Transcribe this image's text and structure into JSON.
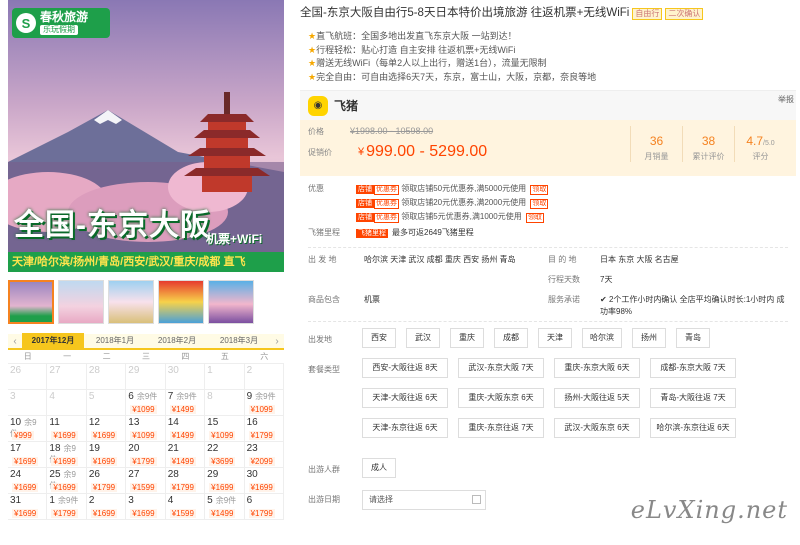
{
  "hero": {
    "logo_title": "春秋旅游",
    "logo_sub": "乐玩假期",
    "headline": "全国-东京大阪",
    "wifi": "机票+WiFi",
    "cities": "天津/哈尔滨/扬州/青岛/西安/武汉/重庆/成都 直飞"
  },
  "calendar": {
    "months": [
      "2017年12月",
      "2018年1月",
      "2018年2月",
      "2018年3月"
    ],
    "active_month": 0,
    "weekdays": [
      "日",
      "一",
      "二",
      "三",
      "四",
      "五",
      "六"
    ],
    "cells": [
      {
        "n": "26",
        "dim": true
      },
      {
        "n": "27",
        "dim": true
      },
      {
        "n": "28",
        "dim": true
      },
      {
        "n": "29",
        "dim": true
      },
      {
        "n": "30",
        "dim": true
      },
      {
        "n": "1",
        "dim": true
      },
      {
        "n": "2",
        "dim": true
      },
      {
        "n": "3",
        "dim": true
      },
      {
        "n": "4",
        "dim": true
      },
      {
        "n": "5",
        "dim": true
      },
      {
        "n": "6",
        "r": "余9件",
        "p": "¥1099"
      },
      {
        "n": "7",
        "r": "余9件",
        "p": "¥1499"
      },
      {
        "n": "8",
        "dim": true
      },
      {
        "n": "9",
        "r": "余9件",
        "p": "¥1099"
      },
      {
        "n": "10",
        "r": "余9件",
        "p": "¥999"
      },
      {
        "n": "11",
        "p": "¥1699"
      },
      {
        "n": "12",
        "p": "¥1699"
      },
      {
        "n": "13",
        "p": "¥1099"
      },
      {
        "n": "14",
        "p": "¥1499"
      },
      {
        "n": "15",
        "p": "¥1099"
      },
      {
        "n": "16",
        "p": "¥1799"
      },
      {
        "n": "17",
        "p": "¥1699"
      },
      {
        "n": "18",
        "r": "余9件",
        "p": "¥1699"
      },
      {
        "n": "19",
        "p": "¥1699"
      },
      {
        "n": "20",
        "p": "¥1799"
      },
      {
        "n": "21",
        "p": "¥1499"
      },
      {
        "n": "22",
        "p": "¥3699"
      },
      {
        "n": "23",
        "p": "¥2099"
      },
      {
        "n": "24",
        "p": "¥1699"
      },
      {
        "n": "25",
        "r": "余9件",
        "p": "¥1699"
      },
      {
        "n": "26",
        "p": "¥1799"
      },
      {
        "n": "27",
        "p": "¥1599"
      },
      {
        "n": "28",
        "p": "¥1799"
      },
      {
        "n": "29",
        "p": "¥1699"
      },
      {
        "n": "30",
        "p": "¥1699"
      },
      {
        "n": "31",
        "p": "¥1699"
      },
      {
        "n": "1",
        "r": "余9件",
        "p": "¥1799"
      },
      {
        "n": "2",
        "p": "¥1699"
      },
      {
        "n": "3",
        "p": "¥1699"
      },
      {
        "n": "4",
        "p": "¥1599"
      },
      {
        "n": "5",
        "r": "余9件",
        "p": "¥1499"
      },
      {
        "n": "6",
        "p": "¥1799"
      }
    ]
  },
  "product": {
    "title": "全国-东京大阪自由行5-8天日本特价出境旅游 往返机票+无线WiFi",
    "tags": [
      "自由行",
      "二次确认"
    ],
    "features": [
      "直飞航班：全国多地出发直飞东京大阪 一站到达！",
      "行程轻松：贴心打造 自主安排 往返机票+无线WiFi",
      "赠送无线WiFi（每单2人以上出行，赠送1台），流量无限制",
      "完全自由：可自由选择6天7天，东京，富士山，大阪，京都，奈良等地"
    ],
    "share": "举报",
    "brand": "飞猪",
    "price_label": "价格",
    "price_old": "¥1998.00 - 10598.00",
    "promo_label": "促销价",
    "promo_yen": "¥",
    "promo_value": "999.00 - 5299.00",
    "stats": [
      {
        "v": "36",
        "u": "",
        "l": "月销量"
      },
      {
        "v": "38",
        "u": "",
        "l": "累计评价"
      },
      {
        "v": "4.7",
        "u": "/5.0",
        "l": "评分"
      }
    ],
    "coupon_label": "优惠",
    "coupons": [
      {
        "b": "店铺",
        "b2": "优惠券",
        "t": "领取店铺50元优惠券,满5000元使用",
        "g": "领取"
      },
      {
        "b": "店铺",
        "b2": "优惠券",
        "t": "领取店铺20元优惠券,满2000元使用",
        "g": "领取"
      },
      {
        "b": "店铺",
        "b2": "优惠券",
        "t": "领取店铺5元优惠券,满1000元使用",
        "g": "领取"
      }
    ],
    "fz_label": "飞猪里程",
    "fz_badge": "飞猪里程",
    "fz_text": "最多可返2649飞猪里程"
  },
  "info": {
    "depart_label": "出 发 地",
    "depart": "哈尔滨 天津 武汉 成都 重庆 西安 扬州 青岛",
    "dest_label": "目 的 地",
    "dest": "日本 东京 大阪 名古屋",
    "days_label": "行程天数",
    "days": "7天",
    "include_label": "商品包含",
    "include": "机票",
    "service_label": "服务承诺",
    "service": "2个工作小时内确认 全店平均确认时长:1小时内 成功率98%"
  },
  "options": {
    "depart_label": "出发地",
    "departs": [
      "西安",
      "武汉",
      "重庆",
      "成都",
      "天津",
      "哈尔滨",
      "扬州",
      "青岛"
    ],
    "pkg_label": "套餐类型",
    "packages": [
      "西安-大阪往返 8天",
      "武汉-东京大阪 7天",
      "重庆-东京大阪 6天",
      "成都-东京大阪 7天",
      "天津-大阪往返 6天",
      "重庆-大阪东京 6天",
      "扬州-大阪往返 5天",
      "青岛-大阪往返 7天",
      "天津-东京往返 6天",
      "重庆-东京往返 7天",
      "武汉-大阪东京 6天",
      "哈尔滨-东京往返 6天"
    ],
    "people_label": "出游人群",
    "people": "成人",
    "date_label": "出游日期",
    "date_placeholder": "请选择"
  },
  "watermark": "eLvXing.net"
}
